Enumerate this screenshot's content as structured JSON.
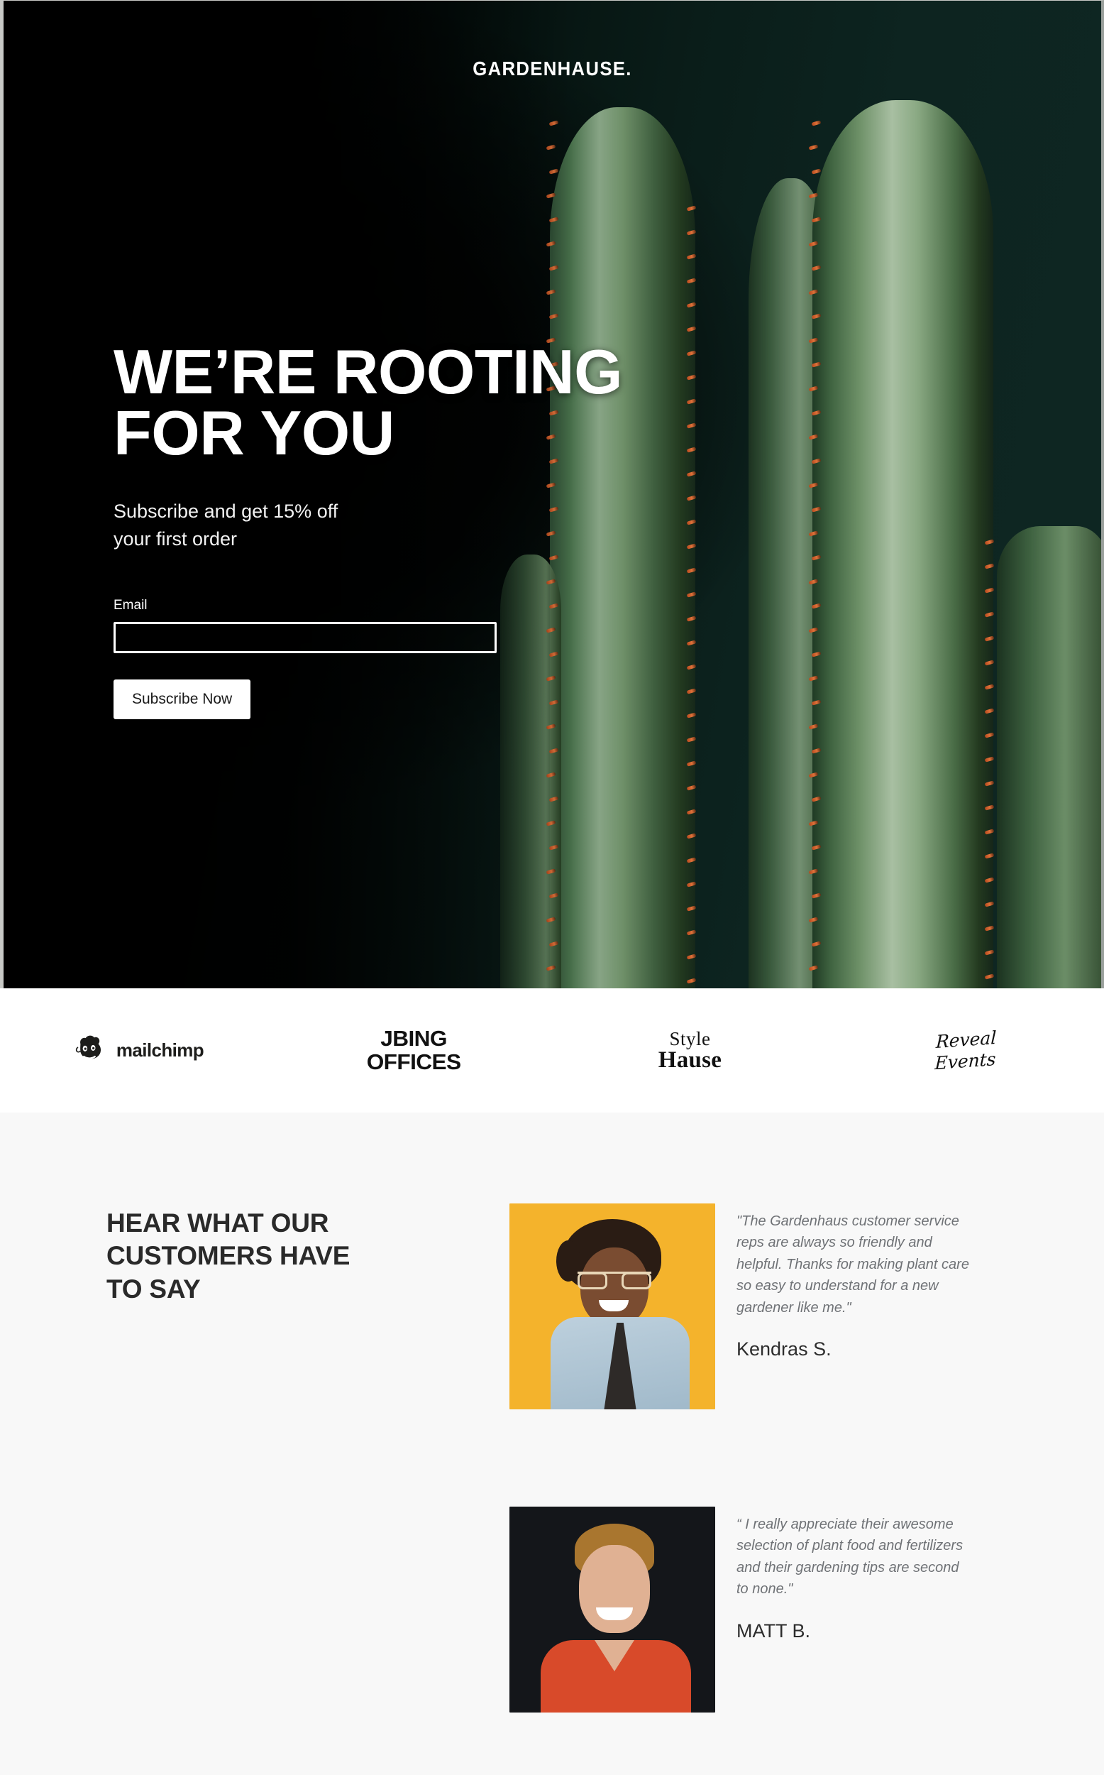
{
  "hero": {
    "logo": "GARDENHAUSE.",
    "title": "WE’RE ROOTING\nFOR YOU",
    "subtitle": "Subscribe and get 15% off\nyour first order",
    "form": {
      "email_label": "Email",
      "email_value": "",
      "email_placeholder": "",
      "submit_label": "Subscribe Now"
    },
    "background_image": "cactus-photo",
    "colors": {
      "background": "#0b1c18",
      "text": "#ffffff",
      "button_bg": "#ffffff",
      "button_text": "#1a1a1a"
    }
  },
  "partner_logos": [
    {
      "name": "mailchimp",
      "wordmark": "mailchimp",
      "icon": "mailchimp-monkey-icon"
    },
    {
      "name": "jbing-offices",
      "line1": "JBING",
      "line2": "OFFICES"
    },
    {
      "name": "style-hause",
      "line1": "Style",
      "line2": "Hause"
    },
    {
      "name": "reveal-events",
      "line1": "Reveal",
      "line2": "Events"
    }
  ],
  "testimonials": {
    "heading": "HEAR WHAT OUR\nCUSTOMERS HAVE\nTO SAY",
    "section_bg": "#f8f8f8",
    "items": [
      {
        "photo": "woman-glasses-denim-yellow-background",
        "photo_bg": "#f4b32c",
        "quote": "\"The Gardenhaus customer service reps are always so friendly and helpful. Thanks for making plant care so easy to understand for a new gardener like me.\"",
        "author": "Kendras S."
      },
      {
        "photo": "man-orange-shirt-black-background",
        "photo_bg": "#14161a",
        "quote": "“ I really appreciate their awesome selection of plant food and fertilizers and their gardening tips are second to none.\"",
        "author": "MATT B."
      }
    ]
  }
}
